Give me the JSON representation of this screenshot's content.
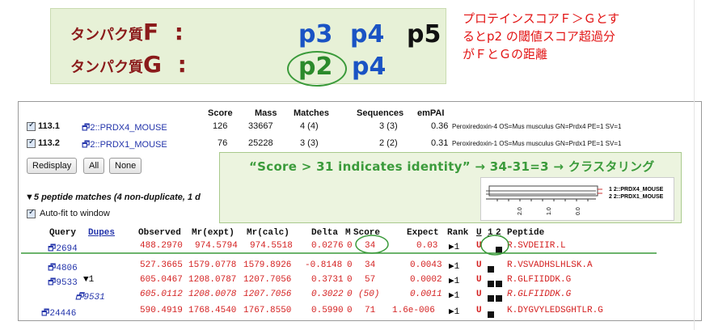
{
  "top": {
    "protein_f_label": "タンパク質",
    "protein_f_letter": "F",
    "protein_g_label": "タンパク質",
    "protein_g_letter": "G",
    "colon": ":",
    "f_codes": [
      "p3",
      "p4",
      "p5"
    ],
    "g_codes": [
      "p2",
      "p4"
    ]
  },
  "note": {
    "lines": [
      "プロテインスコアＦ＞Ｇとす",
      "るとp2 の閾値スコア超過分",
      "がＦとＧの距離"
    ]
  },
  "proteins": {
    "headers": [
      "Score",
      "Mass",
      "Matches",
      "Sequences",
      "emPAI"
    ],
    "rows": [
      {
        "id": "113.1",
        "name": "2::PRDX4_MOUSE",
        "score": "126",
        "mass": "33667",
        "matches": "4 (4)",
        "sequences": "3 (3)",
        "empai": "0.36",
        "desc": "Peroxiredoxin-4 OS=Mus musculus GN=Prdx4 PE=1 SV=1"
      },
      {
        "id": "113.2",
        "name": "2::PRDX1_MOUSE",
        "score": "76",
        "mass": "25228",
        "matches": "3 (3)",
        "sequences": "2 (2)",
        "empai": "0.31",
        "desc": "Peroxiredoxin-1 OS=Mus musculus GN=Prdx1 PE=1 SV=1"
      }
    ]
  },
  "buttons": {
    "redisplay": "Redisplay",
    "all": "All",
    "none": "None"
  },
  "banner": {
    "text": "“Score > 31 indicates identity”  → 34-31=3 → クラスタリング",
    "legend": [
      "1 2::PRDX4_MOUSE",
      "2 2::PRDX1_MOUSE"
    ],
    "ticks": [
      "2.0",
      "1.0",
      "0.0"
    ]
  },
  "matches": {
    "summary": "5 peptide matches (4 non-duplicate, 1 d",
    "autofit": "Auto-fit to window",
    "headers": [
      "Query",
      "Dupes",
      "Observed",
      "Mr(expt)",
      "Mr(calc)",
      "Delta",
      "M",
      "Score",
      "Expect",
      "Rank",
      "U",
      "1",
      "2",
      "Peptide"
    ],
    "rows": [
      {
        "query": "2694",
        "dupes": "",
        "observed": "488.2970",
        "mrexpt": "974.5794",
        "mrcalc": "974.5518",
        "delta": "0.0276",
        "m": "0",
        "score": "34",
        "expect": "0.03",
        "rank": "1",
        "u": "U",
        "peptide": "R.SVDEIIR.L"
      },
      {
        "query": "4806",
        "dupes": "",
        "observed": "527.3665",
        "mrexpt": "1579.0778",
        "mrcalc": "1579.8926",
        "delta": "-0.8148",
        "m": "0",
        "score": "34",
        "expect": "0.0043",
        "rank": "1",
        "u": "U",
        "peptide": "R.VSVADHSLHLSK.A"
      },
      {
        "query": "9533",
        "dupes": "1",
        "observed": "605.0467",
        "mrexpt": "1208.0787",
        "mrcalc": "1207.7056",
        "delta": "0.3731",
        "m": "0",
        "score": "57",
        "expect": "0.0002",
        "rank": "1",
        "u": "U",
        "peptide": "R.GLFIIDDK.G"
      },
      {
        "query": "9531",
        "dupes": "",
        "observed": "605.0112",
        "mrexpt": "1208.0078",
        "mrcalc": "1207.7056",
        "delta": "0.3022",
        "m": "0",
        "score": "(50)",
        "expect": "0.0011",
        "rank": "1",
        "u": "U",
        "peptide": "R.GLFIIDDK.G"
      },
      {
        "query": "24446",
        "dupes": "",
        "observed": "590.4919",
        "mrexpt": "1768.4540",
        "mrcalc": "1767.8550",
        "delta": "0.5990",
        "m": "0",
        "score": "71",
        "expect": "1.6e-006",
        "rank": "1",
        "u": "U",
        "peptide": "K.DYGVYLEDSGHTLR.G"
      }
    ]
  }
}
